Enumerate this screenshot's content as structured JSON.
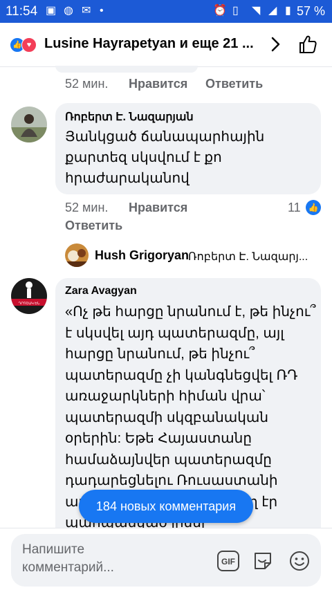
{
  "status_bar": {
    "time": "11:54",
    "battery": "57 %"
  },
  "header": {
    "title": "Lusine Hayrapetyan и еще 21 ..."
  },
  "comment1": {
    "time": "52 мин.",
    "like_label": "Нравится",
    "reply_label": "Ответить"
  },
  "comment2": {
    "author": "Ռոբերտ Է. Նազարյան",
    "lines": [
      "Յանկցած ճանապարհային",
      "քարտեզ սկսվում է քո",
      "հրաժարականով"
    ],
    "time": "52 мин.",
    "like_label": "Нравится",
    "like_count": "11",
    "reply_label": "Ответить"
  },
  "reply_preview": {
    "author": "Hush Grigoryan",
    "snippet": "Ռոբերտ Է. Նազարյ..."
  },
  "comment3": {
    "author": "Zara Avagyan",
    "avatar_text": "ԴՐՈՇԱԿ ԵՆ",
    "lines": [
      "«Ոչ թե հարցը նրանում է, թե ինչու՞",
      "է սկսվել այդ պատերազմը, այլ",
      "հարցը նրանում, թե ինչու՞",
      "պատերազմը չի կանգնեցվել ՌԴ",
      "առաջարկների հիման վրա՝",
      "պատերազմի սկզբանական",
      "օրերին: Եթե Հայաստանը",
      "համաձայնվեր պատերազմը",
      "դադարեցնելու Ռուսաստանի",
      "առաջարկին, ապա կարող էր",
      "պահպանված լինել"
    ]
  },
  "new_comments_button": "184 новых комментария",
  "composer": {
    "placeholder": "Напишите комментарий...",
    "gif_label": "GIF"
  },
  "colors": {
    "accent": "#1877f2",
    "status_bar": "#1c5ad6",
    "bubble": "#f0f2f5",
    "love": "#f33e58"
  }
}
